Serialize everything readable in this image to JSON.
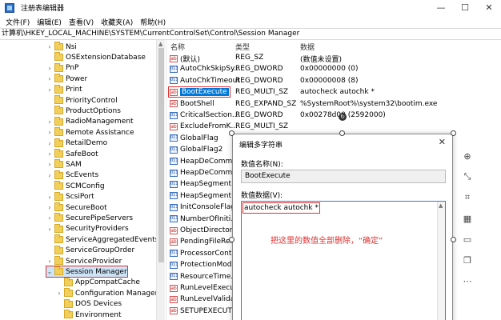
{
  "window": {
    "title": "注册表编辑器",
    "controls": [
      "—",
      "☐",
      "✕"
    ]
  },
  "menu": [
    "文件(F)",
    "编辑(E)",
    "查看(V)",
    "收藏夹(A)",
    "帮助(H)"
  ],
  "address": "计算机\\HKEY_LOCAL_MACHINE\\SYSTEM\\CurrentControlSet\\Control\\Session Manager",
  "tree": {
    "items": [
      {
        "label": "Nsi",
        "level": 0,
        "expand": "›"
      },
      {
        "label": "OSExtensionDatabase",
        "level": 0,
        "expand": ""
      },
      {
        "label": "PnP",
        "level": 0,
        "expand": "›"
      },
      {
        "label": "Power",
        "level": 0,
        "expand": "›"
      },
      {
        "label": "Print",
        "level": 0,
        "expand": "›"
      },
      {
        "label": "PriorityControl",
        "level": 0,
        "expand": ""
      },
      {
        "label": "ProductOptions",
        "level": 0,
        "expand": ""
      },
      {
        "label": "RadioManagement",
        "level": 0,
        "expand": "›"
      },
      {
        "label": "Remote Assistance",
        "level": 0,
        "expand": "›"
      },
      {
        "label": "RetailDemo",
        "level": 0,
        "expand": "›"
      },
      {
        "label": "SafeBoot",
        "level": 0,
        "expand": "›"
      },
      {
        "label": "SAM",
        "level": 0,
        "expand": "›"
      },
      {
        "label": "ScEvents",
        "level": 0,
        "expand": "›"
      },
      {
        "label": "SCMConfig",
        "level": 0,
        "expand": ""
      },
      {
        "label": "ScsiPort",
        "level": 0,
        "expand": "›"
      },
      {
        "label": "SecureBoot",
        "level": 0,
        "expand": "›"
      },
      {
        "label": "SecurePipeServers",
        "level": 0,
        "expand": "›"
      },
      {
        "label": "SecurityProviders",
        "level": 0,
        "expand": "›"
      },
      {
        "label": "ServiceAggregatedEvents",
        "level": 0,
        "expand": ""
      },
      {
        "label": "ServiceGroupOrder",
        "level": 0,
        "expand": ""
      },
      {
        "label": "ServiceProvider",
        "level": 0,
        "expand": "›"
      },
      {
        "label": "Session Manager",
        "level": 0,
        "expand": "⌄",
        "selected": true
      },
      {
        "label": "AppCompatCache",
        "level": 1,
        "expand": ""
      },
      {
        "label": "Configuration Manager",
        "level": 1,
        "expand": "›"
      },
      {
        "label": "DOS Devices",
        "level": 1,
        "expand": ""
      },
      {
        "label": "Environment",
        "level": 1,
        "expand": ""
      }
    ]
  },
  "list": {
    "headers": {
      "name": "名称",
      "type": "类型",
      "data": "数据"
    },
    "rows": [
      {
        "name": "(默认)",
        "type": "REG_SZ",
        "data": "(数值未设置)",
        "icon": "ab"
      },
      {
        "name": "AutoChkSkipSy...",
        "type": "REG_DWORD",
        "data": "0x00000000 (0)",
        "icon": "bin"
      },
      {
        "name": "AutoChkTimeout",
        "type": "REG_DWORD",
        "data": "0x00000008 (8)",
        "icon": "bin"
      },
      {
        "name": "BootExecute",
        "type": "REG_MULTI_SZ",
        "data": "autocheck autochk *",
        "icon": "ab",
        "selected": true
      },
      {
        "name": "BootShell",
        "type": "REG_EXPAND_SZ",
        "data": "%SystemRoot%\\system32\\bootim.exe",
        "icon": "ab"
      },
      {
        "name": "CriticalSection...",
        "type": "REG_DWORD",
        "data": "0x00278d00 (2592000)",
        "icon": "bin"
      },
      {
        "name": "ExcludeFromK...",
        "type": "REG_MULTI_SZ",
        "data": "",
        "icon": "ab"
      },
      {
        "name": "GlobalFlag",
        "type": "",
        "data": "",
        "icon": "bin"
      },
      {
        "name": "GlobalFlag2",
        "type": "",
        "data": "",
        "icon": "bin"
      },
      {
        "name": "HeapDeComm...",
        "type": "",
        "data": "",
        "icon": "bin"
      },
      {
        "name": "HeapDeComm...",
        "type": "",
        "data": "",
        "icon": "bin"
      },
      {
        "name": "HeapSegment...",
        "type": "",
        "data": "",
        "icon": "bin"
      },
      {
        "name": "HeapSegment...",
        "type": "",
        "data": "",
        "icon": "bin"
      },
      {
        "name": "InitConsoleFlags",
        "type": "",
        "data": "",
        "icon": "bin"
      },
      {
        "name": "NumberOfIniti...",
        "type": "",
        "data": "",
        "icon": "bin"
      },
      {
        "name": "ObjectDirector...",
        "type": "",
        "data": "",
        "icon": "ab"
      },
      {
        "name": "PendingFileRe...",
        "type": "",
        "data": "",
        "icon": "ab"
      },
      {
        "name": "ProcessorCont...",
        "type": "",
        "data": "",
        "icon": "bin"
      },
      {
        "name": "ProtectionMode",
        "type": "",
        "data": "",
        "icon": "bin"
      },
      {
        "name": "ResourceTime...",
        "type": "",
        "data": "",
        "icon": "bin"
      },
      {
        "name": "RunLevelExecute",
        "type": "",
        "data": "",
        "icon": "ab"
      },
      {
        "name": "RunLevelValida...",
        "type": "",
        "data": "",
        "icon": "ab"
      },
      {
        "name": "SETUPEXECUTE",
        "type": "",
        "data": "",
        "icon": "ab"
      }
    ]
  },
  "dialog": {
    "title": "编辑多字符串",
    "close": "✕",
    "name_label": "数值名称(N):",
    "name_value": "BootExecute",
    "data_label": "数值数据(V):",
    "data_value": "autocheck autochk *",
    "annotation": "把这里的数值全部删除，“确定”"
  },
  "side_tools": [
    "zoom-icon",
    "resize-icon",
    "crop-icon",
    "mosaic-icon",
    "rectangle-icon",
    "copy-icon",
    "more-icon"
  ],
  "colors": {
    "highlight": "#e03030",
    "selection": "#0078d7",
    "annotation": "#e03030"
  }
}
